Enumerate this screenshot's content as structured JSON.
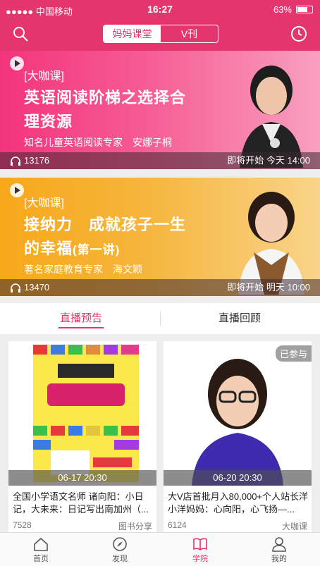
{
  "status": {
    "carrier": "●●●●● 中国移动",
    "time": "16:27",
    "battery": "63%"
  },
  "header": {
    "tabs": [
      "妈妈课堂",
      "V刊"
    ]
  },
  "banners": [
    {
      "tag": "[大咖课]",
      "title": "英语阅读阶梯之选择合理资源",
      "expert": "知名儿童英语阅读专家　安娜子桐",
      "listens": "13176",
      "schedule": "即将开始 今天 14:00"
    },
    {
      "tag": "[大咖课]",
      "title": "接纳力　成就孩子一生的幸福",
      "title_suffix": "(第一讲)",
      "expert": "著名家庭教育专家　海文颖",
      "listens": "13470",
      "schedule": "即将开始 明天 10:00"
    }
  ],
  "tabs": {
    "preview": "直播预告",
    "replay": "直播回顾"
  },
  "cards": [
    {
      "date": "06-17 20:30",
      "desc": "全国小学语文名师 诸向阳：小日记，大未来：日记写出南加州（...",
      "count": "7528",
      "category": "图书分享"
    },
    {
      "date": "06-20 20:30",
      "badge": "已参与",
      "desc": "大V店首批月入80,000+个人站长洋小洋妈妈：心向阳，心飞扬—...",
      "count": "6124",
      "category": "大咖课"
    }
  ],
  "tabbar": [
    "首页",
    "发现",
    "学院",
    "我的"
  ],
  "colors": {
    "brand": "#e5356d"
  }
}
